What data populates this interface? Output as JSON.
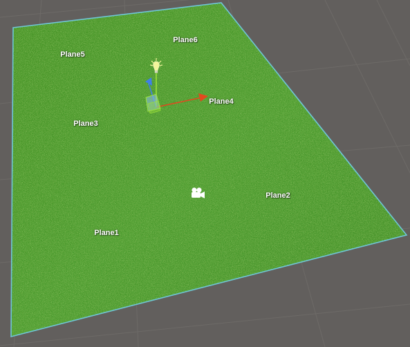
{
  "scene": {
    "labels": {
      "plane1": "Plane1",
      "plane2": "Plane2",
      "plane3": "Plane3",
      "plane4": "Plane4",
      "plane5": "Plane5",
      "plane6": "Plane6"
    },
    "icons": {
      "light": "directional-light-icon",
      "camera": "camera-icon",
      "gizmo": "move-tool-gizmo-icon"
    },
    "colors": {
      "background": "#625f5d",
      "grid_line": "#6f6c69",
      "grass_base": "#3f8f1f",
      "grass_light": "#6cc23a",
      "grass_dark": "#2a6512",
      "selection_outline": "#6fc7d8",
      "axis_x": "#e2491f",
      "axis_y": "#9be03a",
      "axis_z": "#3f7fe8",
      "light_icon": "#f2f59a"
    }
  }
}
